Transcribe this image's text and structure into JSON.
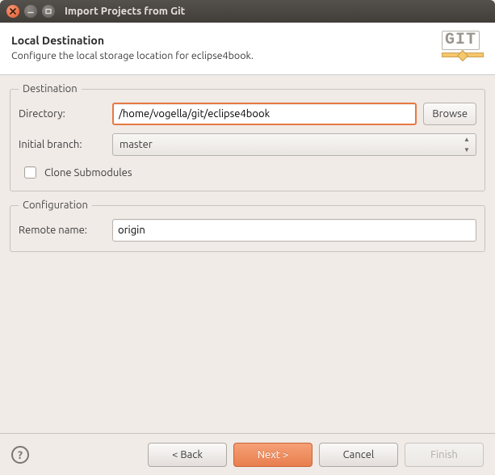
{
  "window": {
    "title": "Import Projects from Git"
  },
  "banner": {
    "title": "Local Destination",
    "subtitle": "Configure the local storage location for eclipse4book.",
    "logo_text": "GIT"
  },
  "destination": {
    "legend": "Destination",
    "directory_label": "Directory:",
    "directory_value": "/home/vogella/git/eclipse4book",
    "browse_label": "Browse",
    "initial_branch_label": "Initial branch:",
    "initial_branch_value": "master",
    "clone_submodules_label": "Clone Submodules",
    "clone_submodules_checked": false
  },
  "configuration": {
    "legend": "Configuration",
    "remote_name_label": "Remote name:",
    "remote_name_value": "origin"
  },
  "footer": {
    "back": "< Back",
    "next": "Next >",
    "cancel": "Cancel",
    "finish": "Finish"
  }
}
